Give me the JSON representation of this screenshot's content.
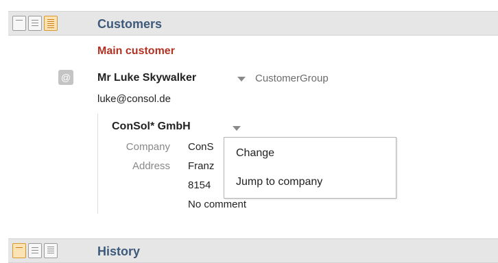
{
  "customers_section": {
    "title": "Customers",
    "role": "Main customer",
    "contact": {
      "name": "Mr Luke Skywalker",
      "group": "CustomerGroup",
      "email": "luke@consol.de",
      "icon": "at-icon"
    },
    "company": {
      "name": "ConSol* GmbH",
      "labels": {
        "company": "Company",
        "address": "Address"
      },
      "values": {
        "company": "ConS",
        "address_line1": "Franz",
        "address_line2": "8154",
        "comment": "No comment"
      }
    },
    "context_menu": {
      "items": [
        "Change",
        "Jump to company"
      ]
    }
  },
  "history_section": {
    "title": "History"
  }
}
